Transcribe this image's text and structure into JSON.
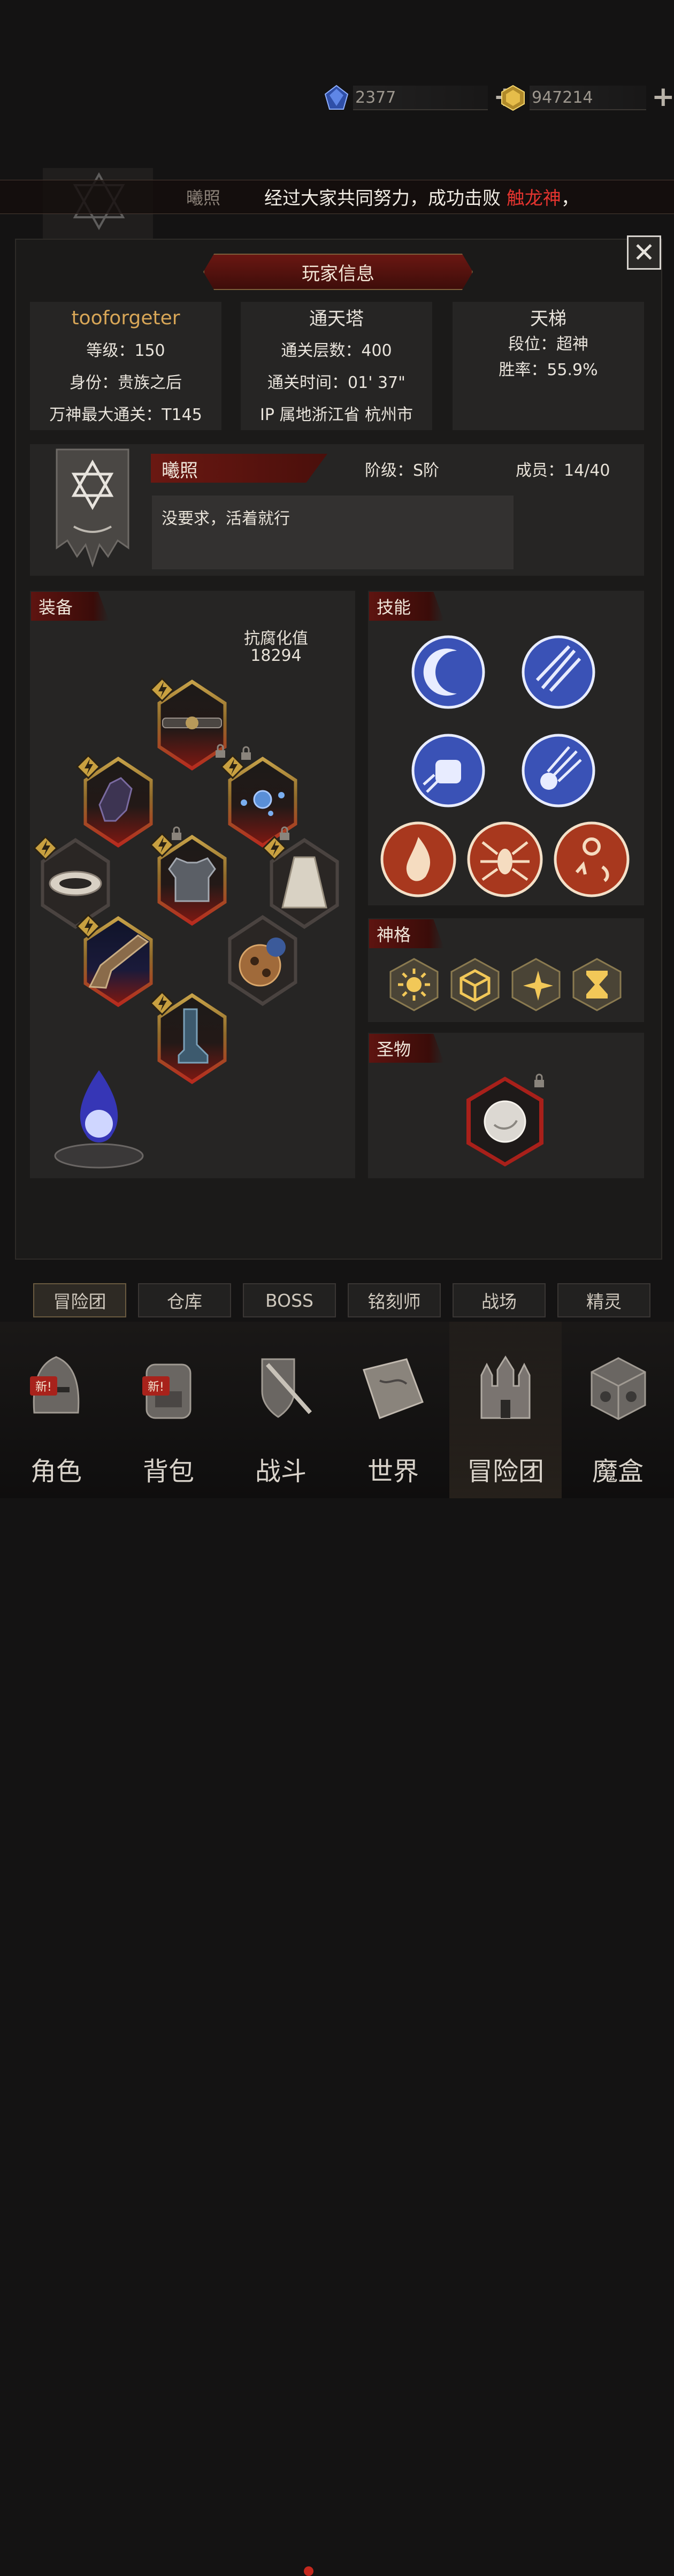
{
  "resources": {
    "gem_blue": "2377",
    "gem_gold": "947214"
  },
  "marquee": {
    "guild": "曦照",
    "prefix": "经过大家共同努力，成功击败 ",
    "highlight": "触龙神",
    "suffix": "，"
  },
  "dialog": {
    "title": "玩家信息",
    "player": {
      "name": "tooforgeter",
      "level": "等级：150",
      "identity": "身份：贵族之后",
      "max_clear": "万神最大通关：T145"
    },
    "tower": {
      "title": "通天塔",
      "floors": "通关层数：400",
      "time": "通关时间：01' 37\"",
      "ip": "IP 属地浙江省 杭州市"
    },
    "ladder": {
      "title": "天梯",
      "rank": "段位：超神",
      "winrate": "胜率：55.9%"
    },
    "guild": {
      "name": "曦照",
      "grade": "阶级：S阶",
      "members": "成员：14/40",
      "motto": "没要求，活着就行"
    },
    "equipment": {
      "header": "装备",
      "stat_label": "抗腐化值",
      "stat_value": "18294"
    },
    "skills": {
      "header": "技能"
    },
    "divinity": {
      "header": "神格"
    },
    "relic": {
      "header": "圣物"
    }
  },
  "tabs": [
    "冒险团",
    "仓库",
    "BOSS",
    "铭刻师",
    "战场",
    "精灵"
  ],
  "nav": [
    {
      "label": "角色",
      "badge": "新!"
    },
    {
      "label": "背包",
      "badge": "新!"
    },
    {
      "label": "战斗"
    },
    {
      "label": "世界"
    },
    {
      "label": "冒险团"
    },
    {
      "label": "魔盒"
    }
  ],
  "colors": {
    "accent_red": "#e3342f",
    "frame_gold": "#c9a44a",
    "header_red": "#5e1410"
  }
}
